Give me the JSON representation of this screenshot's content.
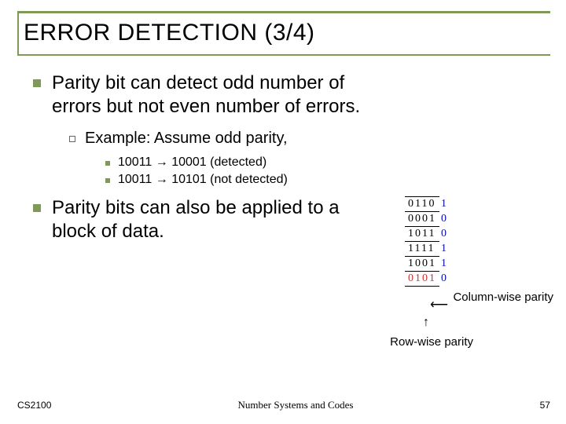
{
  "title": "ERROR DETECTION (3/4)",
  "bullets": {
    "p1": "Parity bit can detect odd number of errors but not even number of errors.",
    "p1a": "Example: Assume odd parity,",
    "p1a1": "10011 → 10001 (detected)",
    "p1a2": "10011 → 10101 (not detected)",
    "p2": "Parity bits can also be applied to a block of data."
  },
  "table": {
    "rows": [
      {
        "data": "0110",
        "p": "1"
      },
      {
        "data": "0001",
        "p": "0"
      },
      {
        "data": "1011",
        "p": "0"
      },
      {
        "data": "1111",
        "p": "1"
      },
      {
        "data": "1001",
        "p": "1"
      },
      {
        "data": "0101",
        "p": "0",
        "highlight": true
      }
    ]
  },
  "labels": {
    "col_parity": "Column-wise parity",
    "row_parity": "Row-wise parity",
    "col_arrow": "⟵",
    "row_arrow": "↑"
  },
  "footer": {
    "left": "CS2100",
    "mid": "Number Systems and Codes",
    "right": "57"
  }
}
